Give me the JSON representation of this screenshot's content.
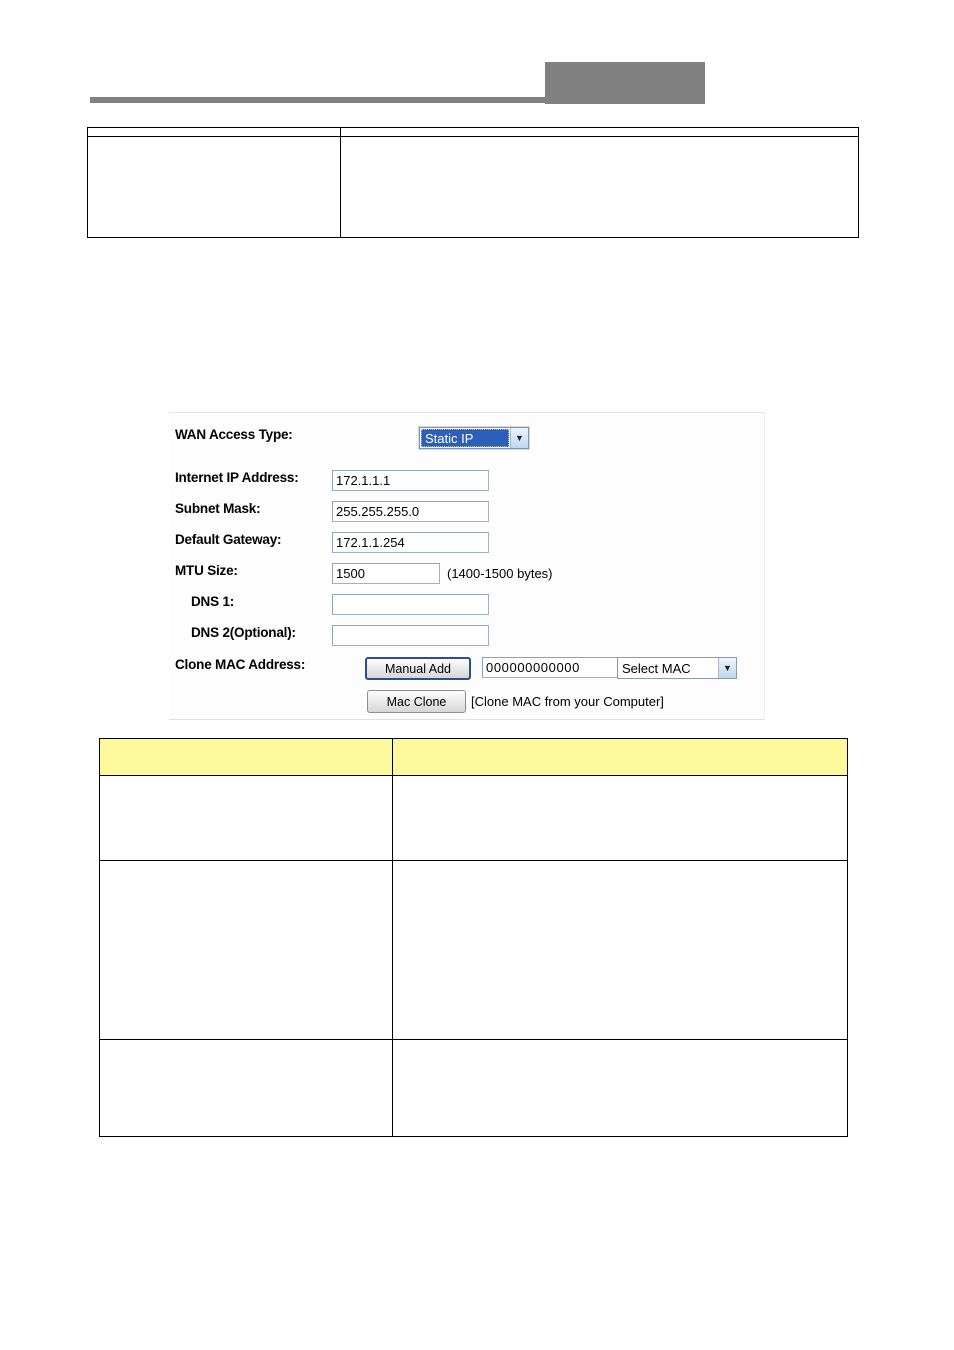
{
  "page": {
    "background": "#ffffff",
    "header": {
      "redacted_block_color": "#808080",
      "rule_color": "#808080"
    }
  },
  "table_top": {
    "name": "parameter-description-table-top",
    "columns": 2,
    "rows": [
      {
        "cells": [
          "",
          ""
        ]
      },
      {
        "cells": [
          "",
          ""
        ]
      }
    ]
  },
  "form": {
    "title": "",
    "fields": {
      "wan_access_type": {
        "label": "WAN Access Type:",
        "value": "Static IP",
        "selected": true
      },
      "internet_ip_address": {
        "label": "Internet IP Address:",
        "value": "172.1.1.1",
        "placeholder": ""
      },
      "subnet_mask": {
        "label": "Subnet Mask:",
        "value": "255.255.255.0",
        "placeholder": ""
      },
      "default_gateway": {
        "label": "Default Gateway:",
        "value": "172.1.1.254",
        "placeholder": ""
      },
      "mtu_size": {
        "label": "MTU Size:",
        "value": "1500",
        "hint": "(1400-1500 bytes)",
        "placeholder": ""
      },
      "dns1": {
        "label": "DNS 1:",
        "value": "",
        "placeholder": ""
      },
      "dns2": {
        "label": "DNS 2(Optional):",
        "value": "",
        "placeholder": ""
      },
      "clone_mac_address": {
        "label": "Clone MAC Address:",
        "manual_add_button": "Manual Add",
        "mac_value": "000000000000",
        "mac_placeholder": "",
        "select_mac_value": "Select MAC",
        "mac_clone_button": "Mac Clone",
        "mac_clone_hint": "[Clone MAC from your Computer]"
      }
    },
    "colors": {
      "select_highlight": "#2b5fba",
      "default_button_ring": "#2b4f86",
      "input_border": "#9cb3c6"
    }
  },
  "table_bottom": {
    "name": "parameter-description-table-bottom",
    "header_background": "#fcf99c",
    "columns": 2,
    "header": [
      "",
      ""
    ],
    "rows": [
      {
        "cells": [
          "",
          ""
        ]
      },
      {
        "cells": [
          "",
          ""
        ]
      },
      {
        "cells": [
          "",
          ""
        ]
      }
    ]
  }
}
